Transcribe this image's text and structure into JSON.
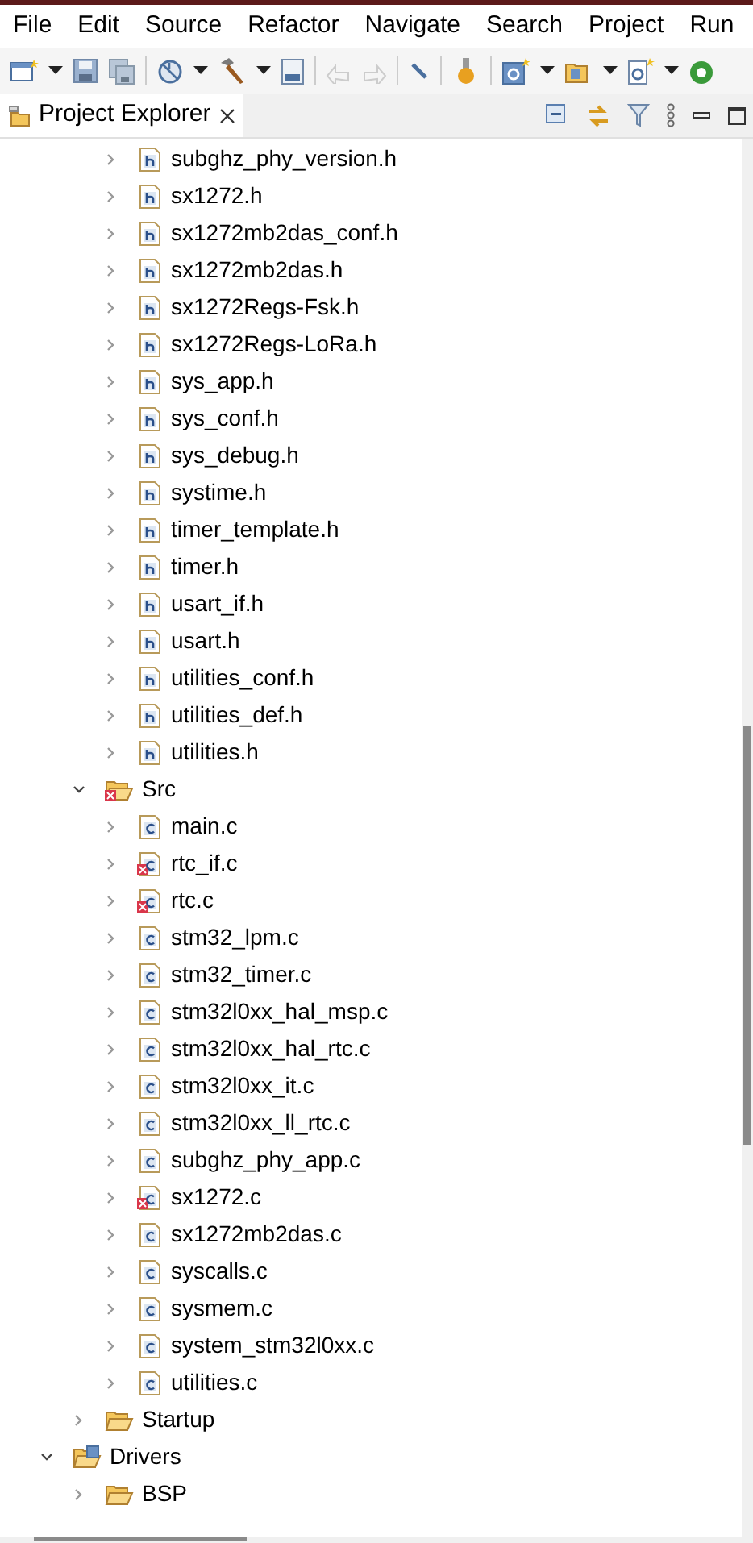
{
  "menu": [
    "File",
    "Edit",
    "Source",
    "Refactor",
    "Navigate",
    "Search",
    "Project",
    "Run"
  ],
  "view": {
    "title": "Project Explorer"
  },
  "tree": [
    {
      "children": [
        {
          "children": [
            {
              "label": "subghz_phy_version.h",
              "kind": "header",
              "expanded": false,
              "error": false
            },
            {
              "label": "sx1272.h",
              "kind": "header",
              "expanded": false,
              "error": false
            },
            {
              "label": "sx1272mb2das_conf.h",
              "kind": "header",
              "expanded": false,
              "error": false
            },
            {
              "label": "sx1272mb2das.h",
              "kind": "header",
              "expanded": false,
              "error": false
            },
            {
              "label": "sx1272Regs-Fsk.h",
              "kind": "header",
              "expanded": false,
              "error": false
            },
            {
              "label": "sx1272Regs-LoRa.h",
              "kind": "header",
              "expanded": false,
              "error": false
            },
            {
              "label": "sys_app.h",
              "kind": "header",
              "expanded": false,
              "error": false
            },
            {
              "label": "sys_conf.h",
              "kind": "header",
              "expanded": false,
              "error": false
            },
            {
              "label": "sys_debug.h",
              "kind": "header",
              "expanded": false,
              "error": false
            },
            {
              "label": "systime.h",
              "kind": "header",
              "expanded": false,
              "error": false
            },
            {
              "label": "timer_template.h",
              "kind": "header",
              "expanded": false,
              "error": false
            },
            {
              "label": "timer.h",
              "kind": "header",
              "expanded": false,
              "error": false
            },
            {
              "label": "usart_if.h",
              "kind": "header",
              "expanded": false,
              "error": false
            },
            {
              "label": "usart.h",
              "kind": "header",
              "expanded": false,
              "error": false
            },
            {
              "label": "utilities_conf.h",
              "kind": "header",
              "expanded": false,
              "error": false
            },
            {
              "label": "utilities_def.h",
              "kind": "header",
              "expanded": false,
              "error": false
            },
            {
              "label": "utilities.h",
              "kind": "header",
              "expanded": false,
              "error": false
            }
          ]
        },
        {
          "label": "Src",
          "kind": "folder",
          "expanded": true,
          "error": true,
          "children": [
            {
              "label": "main.c",
              "kind": "source",
              "expanded": false,
              "error": false
            },
            {
              "label": "rtc_if.c",
              "kind": "source",
              "expanded": false,
              "error": true
            },
            {
              "label": "rtc.c",
              "kind": "source",
              "expanded": false,
              "error": true
            },
            {
              "label": "stm32_lpm.c",
              "kind": "source",
              "expanded": false,
              "error": false
            },
            {
              "label": "stm32_timer.c",
              "kind": "source",
              "expanded": false,
              "error": false
            },
            {
              "label": "stm32l0xx_hal_msp.c",
              "kind": "source",
              "expanded": false,
              "error": false
            },
            {
              "label": "stm32l0xx_hal_rtc.c",
              "kind": "source",
              "expanded": false,
              "error": false
            },
            {
              "label": "stm32l0xx_it.c",
              "kind": "source",
              "expanded": false,
              "error": false
            },
            {
              "label": "stm32l0xx_ll_rtc.c",
              "kind": "source",
              "expanded": false,
              "error": false
            },
            {
              "label": "subghz_phy_app.c",
              "kind": "source",
              "expanded": false,
              "error": false
            },
            {
              "label": "sx1272.c",
              "kind": "source",
              "expanded": false,
              "error": true
            },
            {
              "label": "sx1272mb2das.c",
              "kind": "source",
              "expanded": false,
              "error": false
            },
            {
              "label": "syscalls.c",
              "kind": "source",
              "expanded": false,
              "error": false
            },
            {
              "label": "sysmem.c",
              "kind": "source",
              "expanded": false,
              "error": false
            },
            {
              "label": "system_stm32l0xx.c",
              "kind": "source",
              "expanded": false,
              "error": false
            },
            {
              "label": "utilities.c",
              "kind": "source",
              "expanded": false,
              "error": false
            }
          ]
        },
        {
          "label": "Startup",
          "kind": "folder",
          "expanded": false,
          "error": false
        }
      ]
    },
    {
      "label": "Drivers",
      "kind": "source_folder",
      "expanded": true,
      "error": false,
      "children": [
        {
          "label": "BSP",
          "kind": "folder",
          "expanded": false,
          "error": false
        }
      ]
    }
  ]
}
